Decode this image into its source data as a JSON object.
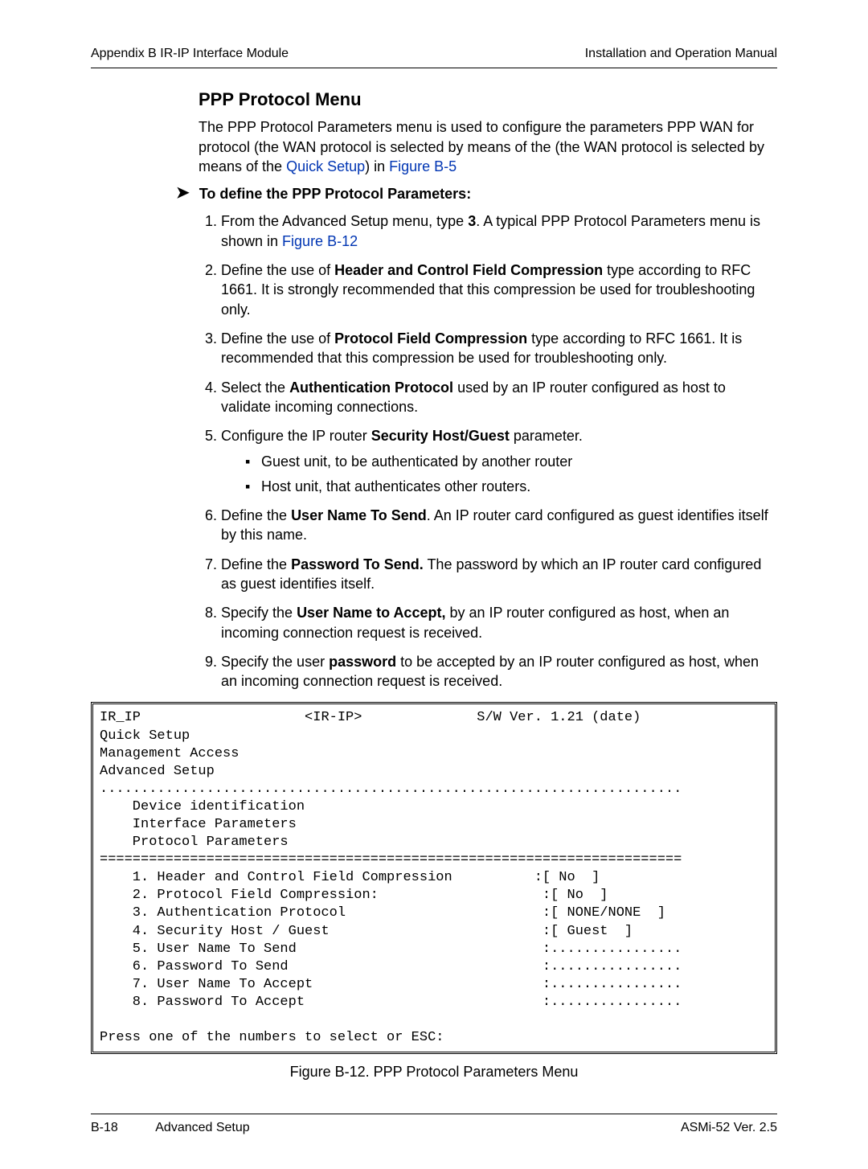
{
  "header": {
    "left": "Appendix B  IR-IP Interface Module",
    "right": "Installation and Operation Manual"
  },
  "section_title": "PPP Protocol Menu",
  "intro": {
    "p1_a": "The PPP Protocol Parameters menu is used to configure the parameters PPP WAN for protocol (the WAN protocol is selected by means of the (the WAN protocol is selected by means of the ",
    "link1": "Quick Setup",
    "p1_b": ") in ",
    "link2": "Figure B-5"
  },
  "procedure_title": "To define the PPP Protocol Parameters:",
  "steps": {
    "s1_a": "From the Advanced Setup menu, type ",
    "s1_bold": "3",
    "s1_b": ". A typical PPP Protocol Parameters menu is shown in ",
    "s1_link": "Figure B-12",
    "s2_a": "Define the use of ",
    "s2_bold": "Header and Control Field Compression",
    "s2_b": " type according to RFC 1661. It is strongly recommended that this compression be used for troubleshooting only.",
    "s3_a": "Define the use of ",
    "s3_bold": "Protocol Field Compression",
    "s3_b": " type according to RFC 1661. It is recommended that this compression be used for troubleshooting only.",
    "s4_a": "Select the ",
    "s4_bold": "Authentication Protocol",
    "s4_b": " used by an IP router configured as host to validate incoming connections.",
    "s5_a": "Configure the IP router ",
    "s5_bold": "Security Host/Guest",
    "s5_b": " parameter.",
    "s5_sub1": "Guest unit, to be authenticated by another router",
    "s5_sub2": "Host unit, that authenticates other routers.",
    "s6_a": "Define the ",
    "s6_bold": "User Name To Send",
    "s6_b": ". An IP router card configured as guest identifies itself by this name.",
    "s7_a": "Define the ",
    "s7_bold": "Password To Send.",
    "s7_b": " The password by which an IP router card configured as guest identifies itself.",
    "s8_a": "Specify the ",
    "s8_bold": "User Name to Accept,",
    "s8_b": " by an IP router configured as host, when an incoming connection request is received.",
    "s9_a": "Specify the user ",
    "s9_bold": "password",
    "s9_b": " to be accepted by an IP router configured as host, when an incoming connection request is received."
  },
  "terminal": "IR_IP                    <IR-IP>              S/W Ver. 1.21 (date)\nQuick Setup\nManagement Access\nAdvanced Setup\n.......................................................................\n    Device identification\n    Interface Parameters\n    Protocol Parameters\n=======================================================================\n    1. Header and Control Field Compression          :[ No  ]\n    2. Protocol Field Compression:                    :[ No  ]\n    3. Authentication Protocol                        :[ NONE/NONE  ]\n    4. Security Host / Guest                          :[ Guest  ]\n    5. User Name To Send                              :................\n    6. Password To Send                               :................\n    7. User Name To Accept                            :................\n    8. Password To Accept                             :................\n\nPress one of the numbers to select or ESC:",
  "figure_caption": "Figure B-12.  PPP Protocol Parameters Menu",
  "footer": {
    "page": "B-18",
    "section": "Advanced Setup",
    "version": "ASMi-52 Ver. 2.5"
  }
}
